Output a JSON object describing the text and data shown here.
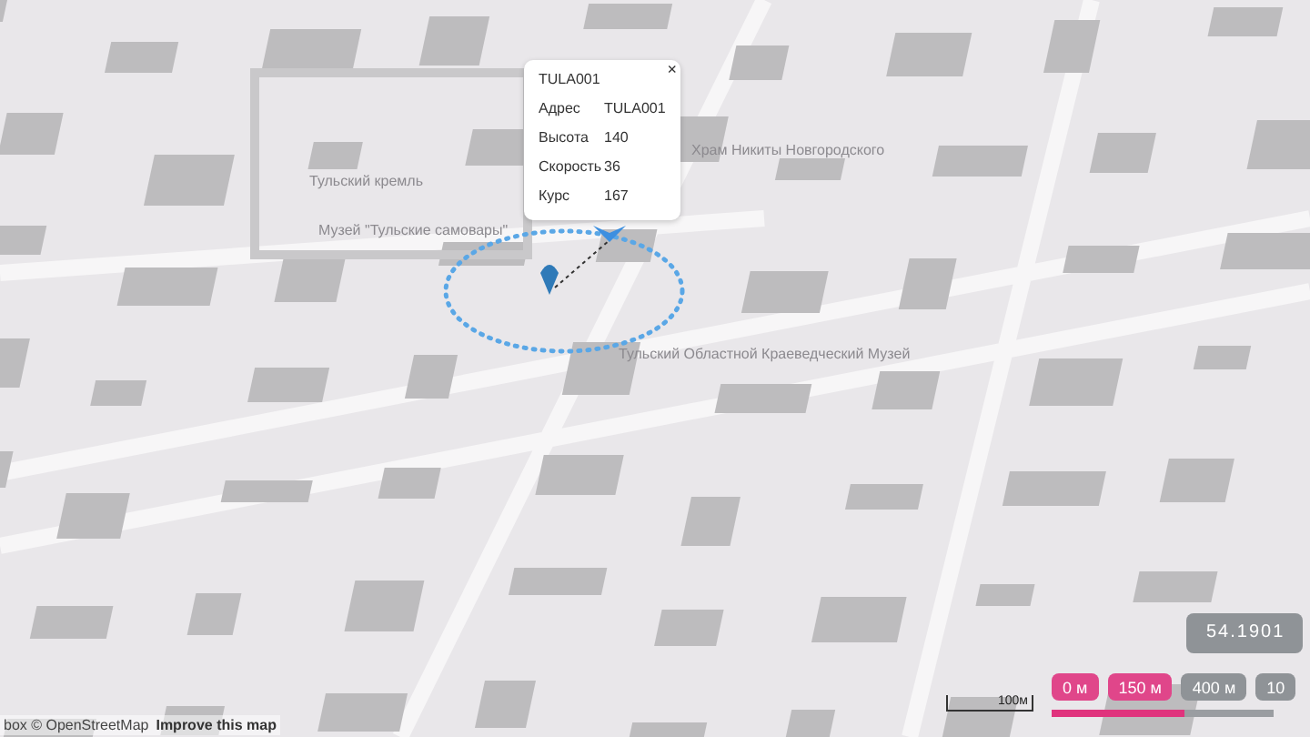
{
  "map_labels": [
    {
      "text": "Тульский кремль"
    },
    {
      "text": "Музей \"Тульские самовары\""
    },
    {
      "text": "Храм Никиты Новгородского"
    },
    {
      "text": "Тульский Областной Краеведческий Музей"
    }
  ],
  "popup": {
    "title": "TULA001",
    "close": "×",
    "fields": [
      {
        "label": "Адрес",
        "value": "TULA001"
      },
      {
        "label": "Высота",
        "value": "140"
      },
      {
        "label": "Скорость",
        "value": "36"
      },
      {
        "label": "Курс",
        "value": "167"
      }
    ]
  },
  "coordinate": "54.1901",
  "scale": "100м",
  "ranges": [
    {
      "label": "0 м",
      "selected": true
    },
    {
      "label": "150 м",
      "selected": true
    },
    {
      "label": "400 м",
      "selected": false
    },
    {
      "label": "10",
      "selected": false
    }
  ],
  "range_track": {
    "level": 0.6
  },
  "attribution": {
    "prefix": "box © OpenStreetMap",
    "link": "Improve this map"
  }
}
